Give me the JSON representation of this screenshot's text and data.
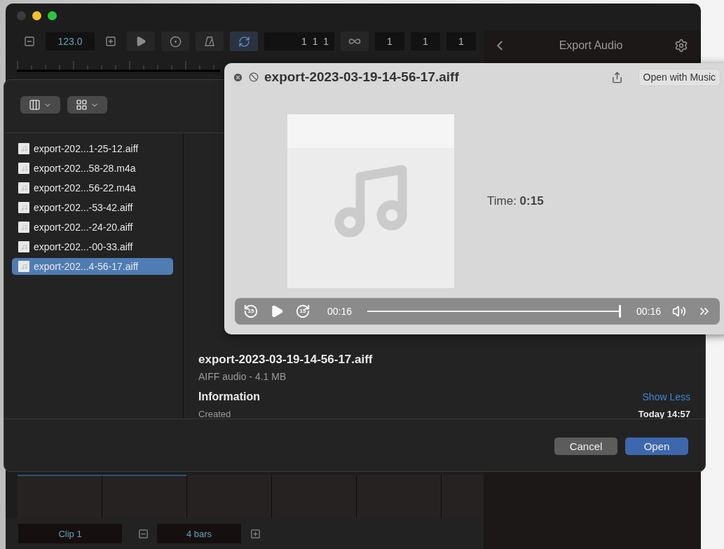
{
  "app": {
    "toolbar": {
      "tempo": "123.0",
      "loop_selected": true,
      "position": "1  1  1",
      "fields": [
        "1",
        "1",
        "1"
      ]
    },
    "side_panel": {
      "title": "Export Audio"
    },
    "footer": {
      "clip": "Clip 1",
      "length": "4 bars"
    }
  },
  "open_dialog": {
    "files": [
      {
        "name": "export-202...1-25-12.aiff",
        "selected": false
      },
      {
        "name": "export-202...58-28.m4a",
        "selected": false
      },
      {
        "name": "export-202...56-22.m4a",
        "selected": false
      },
      {
        "name": "export-202...-53-42.aiff",
        "selected": false
      },
      {
        "name": "export-202...-24-20.aiff",
        "selected": false
      },
      {
        "name": "export-202...-00-33.aiff",
        "selected": false
      },
      {
        "name": "export-202...4-56-17.aiff",
        "selected": true
      }
    ],
    "preview": {
      "file_name": "export-2023-03-19-14-56-17.aiff",
      "kind": "AIFF audio - 4.1 MB",
      "section": "Information",
      "toggle": "Show Less",
      "created_label": "Created",
      "created_value": "Today 14:57"
    },
    "buttons": {
      "cancel": "Cancel",
      "open": "Open"
    }
  },
  "quick_look": {
    "title": "export-2023-03-19-14-56-17.aiff",
    "open_with": "Open with Music",
    "time": "Time: **0:15**",
    "player": {
      "skip_back": "15",
      "skip_forward": "15",
      "elapsed": "00:16",
      "level": 1.0,
      "duration": "00:16"
    }
  }
}
